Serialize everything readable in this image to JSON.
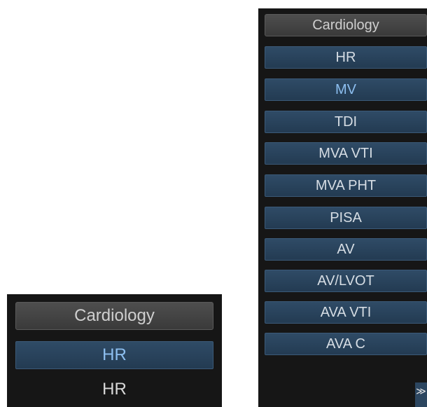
{
  "small_panel": {
    "header": "Cardiology",
    "selected_item": "HR",
    "item": "HR"
  },
  "large_panel": {
    "header": "Cardiology",
    "items": [
      {
        "label": "HR",
        "selected": false
      },
      {
        "label": "MV",
        "selected": true
      },
      {
        "label": "TDI",
        "selected": false
      },
      {
        "label": "MVA VTI",
        "selected": false
      },
      {
        "label": "MVA PHT",
        "selected": false
      },
      {
        "label": "PISA",
        "selected": false
      },
      {
        "label": "AV",
        "selected": false
      },
      {
        "label": "AV/LVOT",
        "selected": false
      },
      {
        "label": "AVA VTI",
        "selected": false
      },
      {
        "label": "AVA C",
        "selected": false
      }
    ],
    "more_glyph": "≫"
  },
  "colors": {
    "panel_bg": "#161616",
    "header_bg": "#424242",
    "button_bg": "#2a4560",
    "selected_text": "#8dbff0",
    "text": "#d6dde4"
  },
  "icons": {
    "more": "double-chevron-down-icon"
  }
}
